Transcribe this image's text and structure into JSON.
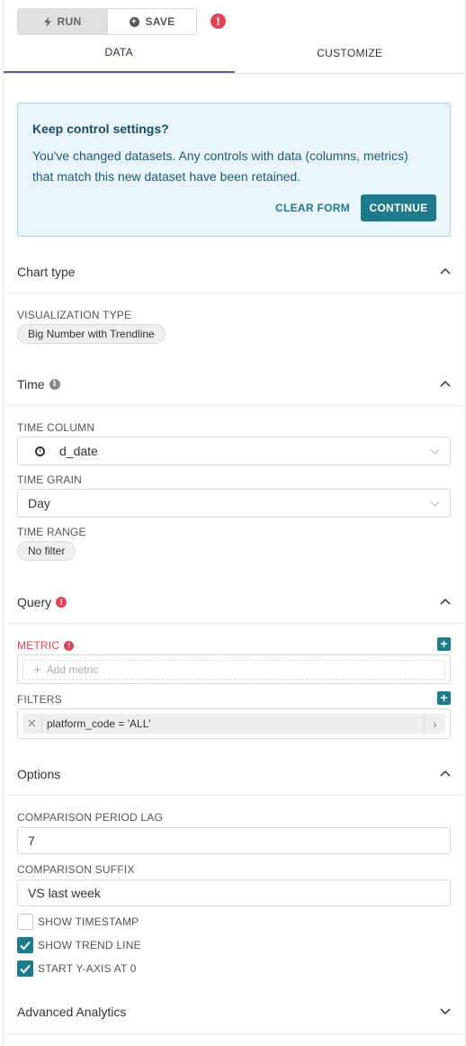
{
  "toolbar": {
    "run_label": "RUN",
    "save_label": "SAVE",
    "run_icon": "bolt-icon",
    "save_icon": "plus-circle-icon",
    "alert_icon": "exclamation-circle-icon",
    "alert_glyph": "!"
  },
  "tabs": [
    {
      "label": "DATA",
      "active": true
    },
    {
      "label": "CUSTOMIZE",
      "active": false
    }
  ],
  "notice": {
    "title": "Keep control settings?",
    "body": "You've changed datasets. Any controls with data (columns, metrics) that match this new dataset have been retained.",
    "clear_label": "CLEAR FORM",
    "continue_label": "CONTINUE"
  },
  "sections": {
    "chart_type": {
      "title": "Chart type",
      "expanded": true
    },
    "time": {
      "title": "Time",
      "expanded": true
    },
    "query": {
      "title": "Query",
      "expanded": true
    },
    "options": {
      "title": "Options",
      "expanded": true
    },
    "advanced": {
      "title": "Advanced Analytics",
      "expanded": false
    }
  },
  "chart_type": {
    "viz_label": "VISUALIZATION TYPE",
    "viz_value": "Big Number with Trendline"
  },
  "time": {
    "column_label": "TIME COLUMN",
    "column_value": "d_date",
    "grain_label": "TIME GRAIN",
    "grain_value": "Day",
    "range_label": "TIME RANGE",
    "range_value": "No filter"
  },
  "query": {
    "metric_label": "METRIC",
    "metric_placeholder": "Add metric",
    "filters_label": "FILTERS",
    "filter_value": "platform_code = 'ALL'"
  },
  "options": {
    "lag_label": "COMPARISON PERIOD LAG",
    "lag_value": "7",
    "suffix_label": "COMPARISON SUFFIX",
    "suffix_value": "VS last week",
    "checkboxes": [
      {
        "label": "SHOW TIMESTAMP",
        "checked": false
      },
      {
        "label": "SHOW TREND LINE",
        "checked": true
      },
      {
        "label": "START Y-AXIS AT 0",
        "checked": true
      }
    ]
  },
  "colors": {
    "accent": "#1f7a8c",
    "error": "#e04355",
    "notice_bg": "#eaf5fb",
    "tab_underline": "#5a5f8f"
  }
}
